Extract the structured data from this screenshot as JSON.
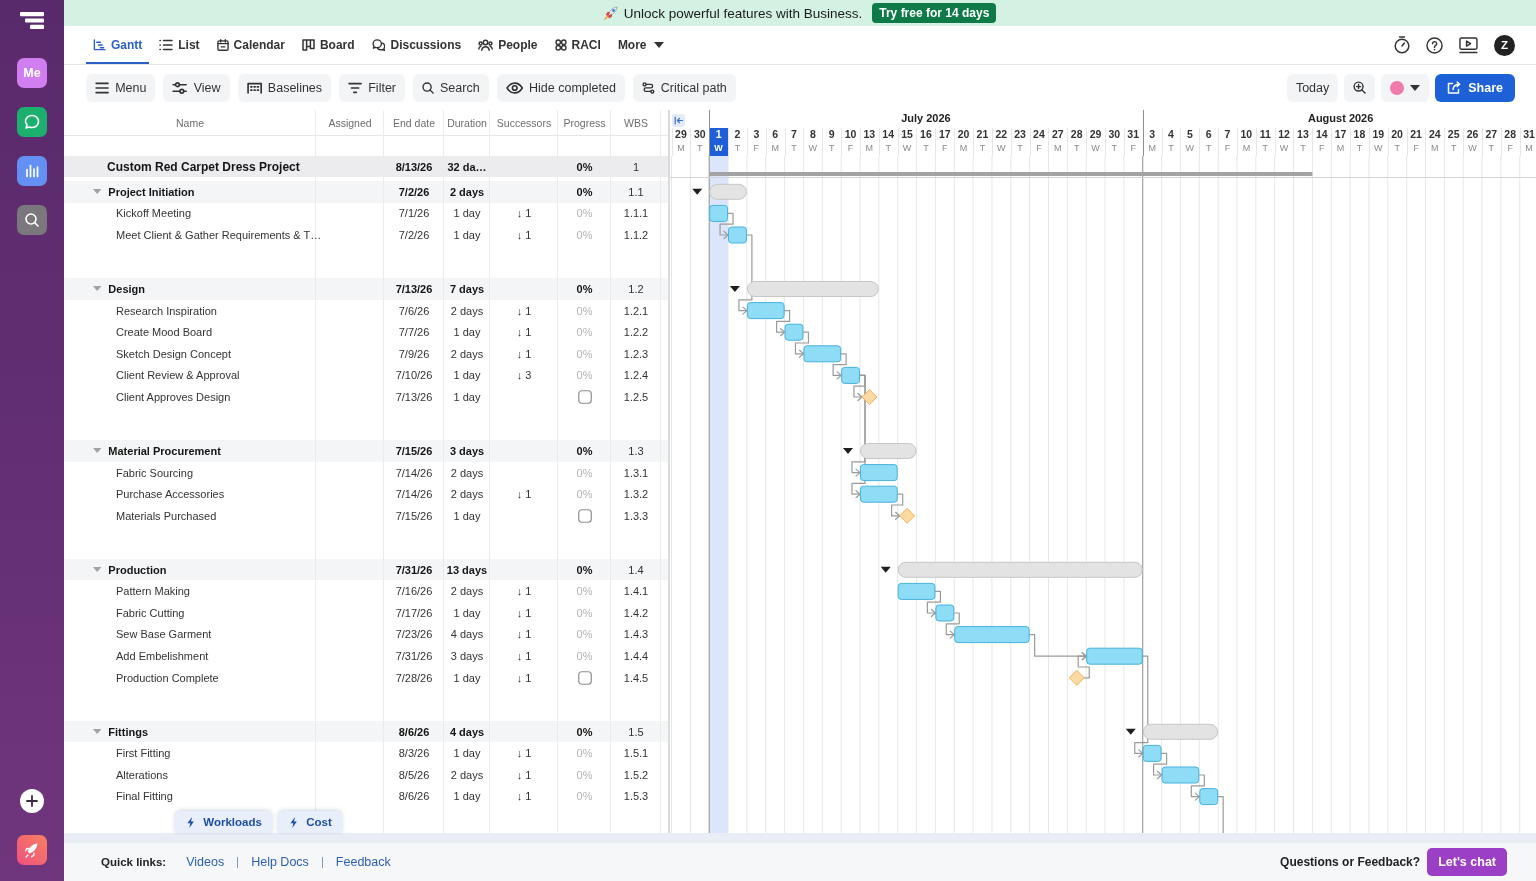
{
  "banner": {
    "text": "Unlock powerful features with Business.",
    "button": "Try free for 14 days"
  },
  "sidebar": {
    "profile_label": "Me"
  },
  "tabs": [
    {
      "label": "Gantt",
      "selected": true
    },
    {
      "label": "List",
      "selected": false
    },
    {
      "label": "Calendar",
      "selected": false
    },
    {
      "label": "Board",
      "selected": false
    },
    {
      "label": "Discussions",
      "selected": false
    },
    {
      "label": "People",
      "selected": false
    },
    {
      "label": "RACI",
      "selected": false
    }
  ],
  "more_menu": {
    "label": "More"
  },
  "account": {
    "initial": "Z"
  },
  "toolbar": {
    "buttons": [
      "Menu",
      "View",
      "Baselines",
      "Filter",
      "Search",
      "Hide completed",
      "Critical path"
    ],
    "today_button": "Today",
    "share_button": "Share"
  },
  "table": {
    "columns": [
      "Name",
      "Assigned",
      "End date",
      "Duration",
      "Successors",
      "Progress",
      "WBS"
    ],
    "project": {
      "name": "Custom Red Carpet Dress Project",
      "end_date": "8/13/26",
      "duration": "32 da…",
      "progress": "0%",
      "wbs": "1",
      "children": [
        {
          "name": "Project Initiation",
          "end_date": "7/2/26",
          "duration": "2 days",
          "progress": "0%",
          "wbs": "1.1",
          "expanded": true,
          "children": [
            {
              "kind": "task",
              "name": "Kickoff Meeting",
              "end_date": "7/1/26",
              "duration": "1 day",
              "successors": "↓ 1",
              "progress": "0%",
              "wbs": "1.1.1"
            },
            {
              "kind": "task",
              "name": "Meet Client & Gather Requirements & T…",
              "end_date": "7/2/26",
              "duration": "1 day",
              "successors": "↓ 1",
              "progress": "0%",
              "wbs": "1.1.2"
            }
          ]
        },
        {
          "name": "Design",
          "end_date": "7/13/26",
          "duration": "7 days",
          "progress": "0%",
          "wbs": "1.2",
          "expanded": true,
          "children": [
            {
              "kind": "task",
              "name": "Research Inspiration",
              "end_date": "7/6/26",
              "duration": "2 days",
              "successors": "↓ 1",
              "progress": "0%",
              "wbs": "1.2.1"
            },
            {
              "kind": "task",
              "name": "Create Mood Board",
              "end_date": "7/7/26",
              "duration": "1 day",
              "successors": "↓ 1",
              "progress": "0%",
              "wbs": "1.2.2"
            },
            {
              "kind": "task",
              "name": "Sketch Design Concept",
              "end_date": "7/9/26",
              "duration": "2 days",
              "successors": "↓ 1",
              "progress": "0%",
              "wbs": "1.2.3"
            },
            {
              "kind": "task",
              "name": "Client Review & Approval",
              "end_date": "7/10/26",
              "duration": "1 day",
              "successors": "↓ 3",
              "progress": "0%",
              "wbs": "1.2.4"
            },
            {
              "kind": "milestone",
              "name": "Client Approves Design",
              "end_date": "7/13/26",
              "duration": "1 day",
              "checked": false,
              "wbs": "1.2.5"
            }
          ]
        },
        {
          "name": "Material Procurement",
          "end_date": "7/15/26",
          "duration": "3 days",
          "progress": "0%",
          "wbs": "1.3",
          "expanded": true,
          "children": [
            {
              "kind": "task",
              "name": "Fabric Sourcing",
              "end_date": "7/14/26",
              "duration": "2 days",
              "progress": "0%",
              "wbs": "1.3.1"
            },
            {
              "kind": "task",
              "name": "Purchase Accessories",
              "end_date": "7/14/26",
              "duration": "2 days",
              "successors": "↓ 1",
              "progress": "0%",
              "wbs": "1.3.2"
            },
            {
              "kind": "milestone",
              "name": "Materials Purchased",
              "end_date": "7/15/26",
              "duration": "1 day",
              "checked": false,
              "wbs": "1.3.3"
            }
          ]
        },
        {
          "name": "Production",
          "end_date": "7/31/26",
          "duration": "13 days",
          "progress": "0%",
          "wbs": "1.4",
          "expanded": true,
          "children": [
            {
              "kind": "task",
              "name": "Pattern Making",
              "end_date": "7/16/26",
              "duration": "2 days",
              "successors": "↓ 1",
              "progress": "0%",
              "wbs": "1.4.1"
            },
            {
              "kind": "task",
              "name": "Fabric Cutting",
              "end_date": "7/17/26",
              "duration": "1 day",
              "successors": "↓ 1",
              "progress": "0%",
              "wbs": "1.4.2"
            },
            {
              "kind": "task",
              "name": "Sew Base Garment",
              "end_date": "7/23/26",
              "duration": "4 days",
              "successors": "↓ 1",
              "progress": "0%",
              "wbs": "1.4.3"
            },
            {
              "kind": "task",
              "name": "Add Embelishment",
              "end_date": "7/31/26",
              "duration": "3 days",
              "successors": "↓ 1",
              "progress": "0%",
              "wbs": "1.4.4"
            },
            {
              "kind": "milestone",
              "name": "Production Complete",
              "end_date": "7/28/26",
              "duration": "1 day",
              "successors": "↓ 1",
              "checked": false,
              "wbs": "1.4.5"
            }
          ]
        },
        {
          "name": "Fittings",
          "end_date": "8/6/26",
          "duration": "4 days",
          "progress": "0%",
          "wbs": "1.5",
          "expanded": true,
          "children": [
            {
              "kind": "task",
              "name": "First Fitting",
              "end_date": "8/3/26",
              "duration": "1 day",
              "successors": "↓ 1",
              "progress": "0%",
              "wbs": "1.5.1"
            },
            {
              "kind": "task",
              "name": "Alterations",
              "end_date": "8/5/26",
              "duration": "2 days",
              "successors": "↓ 1",
              "progress": "0%",
              "wbs": "1.5.2"
            },
            {
              "kind": "task",
              "name": "Final Fitting",
              "end_date": "8/6/26",
              "duration": "1 day",
              "successors": "↓ 1",
              "progress": "0%",
              "wbs": "1.5.3"
            }
          ]
        }
      ]
    }
  },
  "timeline": {
    "months": [
      {
        "days": [
          {
            "date": "29",
            "weekday": "M",
            "selected": false
          },
          {
            "date": "30",
            "weekday": "T",
            "selected": false
          }
        ]
      },
      {
        "label": "July 2026",
        "days": [
          {
            "date": "1",
            "weekday": "W",
            "selected": true
          },
          {
            "date": "2",
            "weekday": "T",
            "selected": false
          },
          {
            "date": "3",
            "weekday": "F",
            "selected": false
          },
          {
            "date": "6",
            "weekday": "M",
            "selected": false
          },
          {
            "date": "7",
            "weekday": "T",
            "selected": false
          },
          {
            "date": "8",
            "weekday": "W",
            "selected": false
          },
          {
            "date": "9",
            "weekday": "T",
            "selected": false
          },
          {
            "date": "10",
            "weekday": "F",
            "selected": false
          },
          {
            "date": "13",
            "weekday": "M",
            "selected": false
          },
          {
            "date": "14",
            "weekday": "T",
            "selected": false
          },
          {
            "date": "15",
            "weekday": "W",
            "selected": false
          },
          {
            "date": "16",
            "weekday": "T",
            "selected": false
          },
          {
            "date": "17",
            "weekday": "F",
            "selected": false
          },
          {
            "date": "20",
            "weekday": "M",
            "selected": false
          },
          {
            "date": "21",
            "weekday": "T",
            "selected": false
          },
          {
            "date": "22",
            "weekday": "W",
            "selected": false
          },
          {
            "date": "23",
            "weekday": "T",
            "selected": false
          },
          {
            "date": "24",
            "weekday": "F",
            "selected": false
          },
          {
            "date": "27",
            "weekday": "M",
            "selected": false
          },
          {
            "date": "28",
            "weekday": "T",
            "selected": false
          },
          {
            "date": "29",
            "weekday": "W",
            "selected": false
          },
          {
            "date": "30",
            "weekday": "T",
            "selected": false
          },
          {
            "date": "31",
            "weekday": "F",
            "selected": false
          }
        ]
      },
      {
        "label": "August 2026",
        "days": [
          {
            "date": "3",
            "weekday": "M",
            "selected": false
          },
          {
            "date": "4",
            "weekday": "T",
            "selected": false
          },
          {
            "date": "5",
            "weekday": "W",
            "selected": false
          },
          {
            "date": "6",
            "weekday": "T",
            "selected": false
          },
          {
            "date": "7",
            "weekday": "F",
            "selected": false
          },
          {
            "date": "10",
            "weekday": "M",
            "selected": false
          },
          {
            "date": "11",
            "weekday": "T",
            "selected": false
          },
          {
            "date": "12",
            "weekday": "W",
            "selected": false
          },
          {
            "date": "13",
            "weekday": "T",
            "selected": false
          },
          {
            "date": "14",
            "weekday": "F",
            "selected": false
          },
          {
            "date": "17",
            "weekday": "M",
            "selected": false
          },
          {
            "date": "18",
            "weekday": "T",
            "selected": false
          },
          {
            "date": "19",
            "weekday": "W",
            "selected": false
          },
          {
            "date": "20",
            "weekday": "T",
            "selected": false
          },
          {
            "date": "21",
            "weekday": "F",
            "selected": false
          },
          {
            "date": "24",
            "weekday": "M",
            "selected": false
          },
          {
            "date": "25",
            "weekday": "T",
            "selected": false
          },
          {
            "date": "26",
            "weekday": "W",
            "selected": false
          },
          {
            "date": "27",
            "weekday": "T",
            "selected": false
          },
          {
            "date": "28",
            "weekday": "F",
            "selected": false
          },
          {
            "date": "31",
            "weekday": "M",
            "selected": false
          }
        ]
      }
    ]
  },
  "quick_actions": [
    "Workloads",
    "Cost"
  ],
  "footer": {
    "quick_links_label": "Quick links:",
    "links": [
      "Videos",
      "Help Docs",
      "Feedback"
    ],
    "help_text": "Questions or Feedback?",
    "chat_button": "Let's chat"
  }
}
